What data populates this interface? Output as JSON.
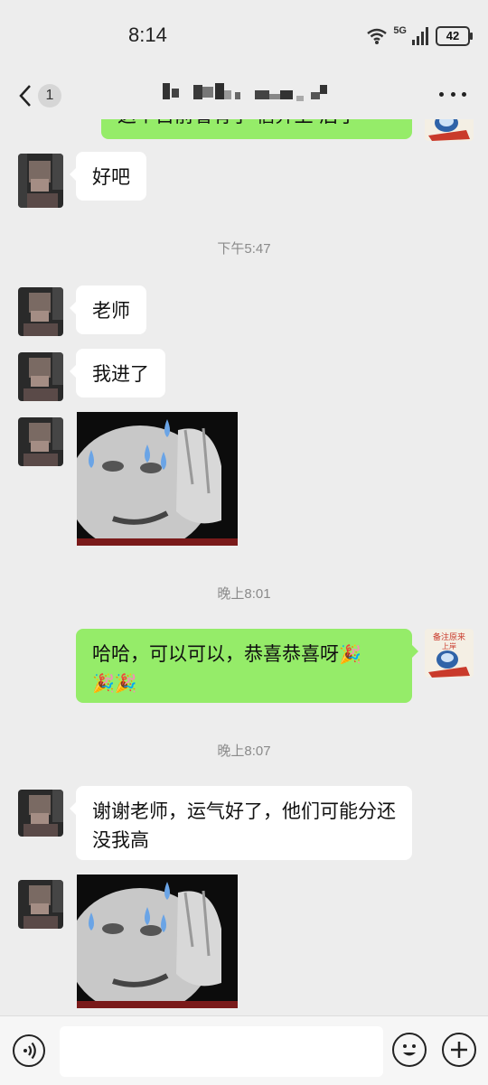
{
  "status_bar": {
    "time": "8:14",
    "network": "5G",
    "battery": "42"
  },
  "nav": {
    "unread_count": "1"
  },
  "messages": {
    "top_partial_text": "这个目前看有了 信弃上 后了",
    "m1": "好吧",
    "t1": "下午5:47",
    "m2": "老师",
    "m3": "我进了",
    "t2": "晚上8:01",
    "mine1_text": "哈哈，可以可以，恭喜恭喜呀",
    "t3": "晚上8:07",
    "m4": "谢谢老师，运气好了，他们可能分还没我高"
  },
  "my_avatar": {
    "line1": "备注原来",
    "line2": "上岸"
  },
  "input": {
    "placeholder": ""
  },
  "colors": {
    "background": "#ededed",
    "my_bubble": "#95ec69",
    "their_bubble": "#ffffff"
  }
}
